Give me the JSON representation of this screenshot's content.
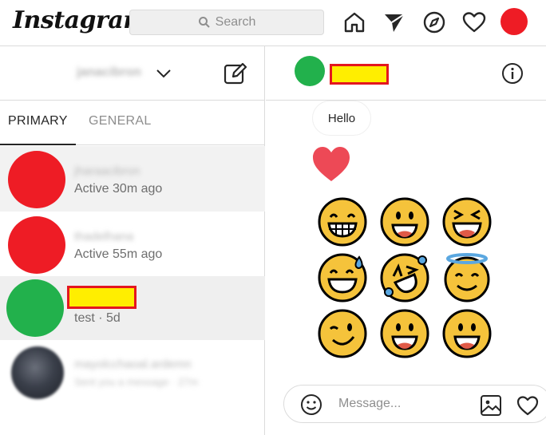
{
  "topbar": {
    "logo_text": "Instagram",
    "search_placeholder": "Search",
    "icons": [
      "home-icon",
      "direct-send-icon",
      "explore-compass-icon",
      "activity-heart-icon",
      "profile-avatar"
    ]
  },
  "inbox": {
    "username": "janacibron",
    "tabs": [
      {
        "label": "PRIMARY",
        "active": true
      },
      {
        "label": "GENERAL",
        "active": false
      }
    ],
    "threads": [
      {
        "name": "jharaacibron",
        "subtitle": "Active 30m ago",
        "avatar_color": "#ee1c25",
        "redacted": false,
        "blurred": false
      },
      {
        "name": "thadelhana",
        "subtitle": "Active 55m ago",
        "avatar_color": "#ee1c25",
        "redacted": false,
        "blurred": false
      },
      {
        "name": "",
        "subtitle": "test · 5d",
        "avatar_color": "#22b14c",
        "redacted": true,
        "selected": true
      },
      {
        "name": "mayolcchaoal.ardemn",
        "subtitle": "Sent you a message · 27m",
        "avatar_color": "#3a3f4a",
        "blurred": true
      }
    ]
  },
  "chat": {
    "header_avatar_color": "#22b14c",
    "messages": [
      {
        "type": "text",
        "text": "Hello"
      },
      {
        "type": "heart"
      },
      {
        "type": "emoji",
        "names": [
          "grinning",
          "grinning-face-big-eyes",
          "squinting-laughing",
          "grinning-sweat",
          "rolling-on-floor-laughing",
          "smiling-halo",
          "winking",
          "grinning-face-big-eyes",
          "grinning-face-big-eyes"
        ]
      }
    ],
    "composer_placeholder": "Message..."
  },
  "colors": {
    "accent_red": "#ee1c25",
    "accent_green": "#22b14c",
    "redaction_yellow": "#ffee00",
    "heart_red": "#ed4956",
    "emoji_yellow": "#f5c33b"
  }
}
